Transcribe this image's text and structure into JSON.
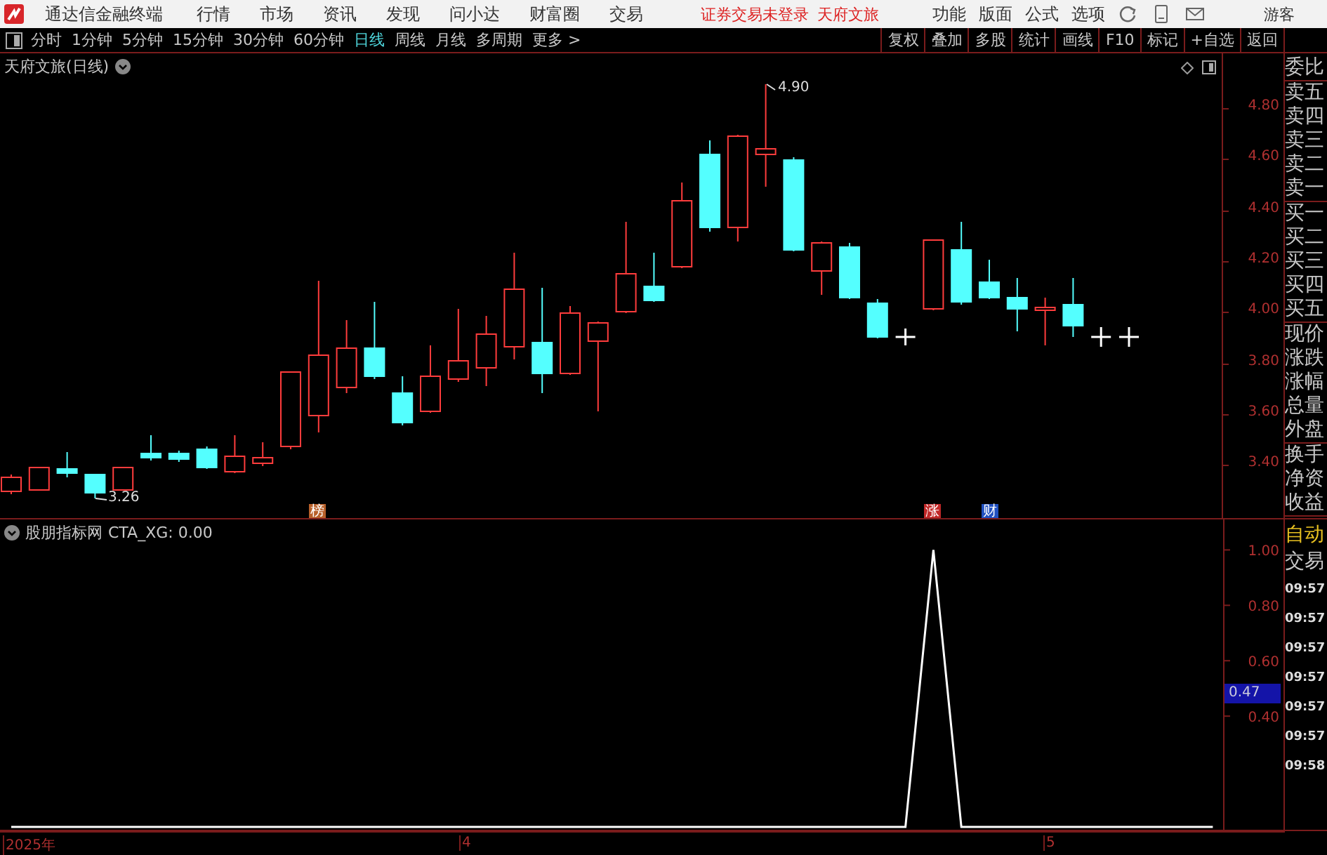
{
  "menu_bar": {
    "app_title": "通达信金融终端",
    "items": [
      "行情",
      "市场",
      "资讯",
      "发现",
      "问小达",
      "财富圈",
      "交易"
    ],
    "login_status": "证券交易未登录",
    "stock_name": "天府文旅",
    "right_items": [
      "功能",
      "版面",
      "公式",
      "选项"
    ],
    "user": "游客"
  },
  "period_bar": {
    "periods": [
      {
        "label": "分时",
        "selected": false
      },
      {
        "label": "1分钟",
        "selected": false
      },
      {
        "label": "5分钟",
        "selected": false
      },
      {
        "label": "15分钟",
        "selected": false
      },
      {
        "label": "30分钟",
        "selected": false
      },
      {
        "label": "60分钟",
        "selected": false
      },
      {
        "label": "日线",
        "selected": true
      },
      {
        "label": "周线",
        "selected": false
      },
      {
        "label": "月线",
        "selected": false
      },
      {
        "label": "多周期",
        "selected": false
      },
      {
        "label": "更多 >",
        "selected": false
      }
    ],
    "tools": [
      "复权",
      "叠加",
      "多股",
      "统计",
      "画线",
      "F10",
      "标记",
      "+自选",
      "返回"
    ]
  },
  "main_chart": {
    "title": "天府文旅(日线)",
    "high_label": "4.90",
    "low_label": "3.26",
    "price_ticks": [
      "4.80",
      "4.60",
      "4.40",
      "4.20",
      "4.00",
      "3.80",
      "3.60",
      "3.40"
    ],
    "markers": [
      {
        "label": "榜",
        "color": "#b8602a"
      },
      {
        "label": "涨",
        "color": "#c02828"
      },
      {
        "label": "财",
        "color": "#2050c0"
      }
    ]
  },
  "indicator": {
    "source": "股朋指标网",
    "reading": "CTA_XG: 0.00",
    "cursor_value": "0.47",
    "chart_data": {
      "type": "line",
      "ylim": [
        0,
        1.11
      ],
      "categories": [
        null,
        null,
        null,
        null,
        null,
        null,
        null,
        null,
        null,
        null,
        null,
        null,
        null,
        null,
        null,
        null,
        null,
        null,
        null,
        null,
        null,
        null,
        null,
        null,
        null,
        null,
        null,
        null,
        null,
        null,
        null,
        null,
        null,
        null,
        null,
        null,
        null,
        null,
        null,
        null,
        null,
        null,
        null,
        null
      ],
      "yticks": [
        {
          "value": 0.4,
          "label": "0.40"
        },
        {
          "value": 0.6,
          "label": "0.60"
        },
        {
          "value": 0.8,
          "label": "0.80"
        },
        {
          "value": 1,
          "label": "1.00"
        }
      ],
      "series": [
        {
          "color": "#ffffff",
          "values": [
            0,
            0,
            0,
            0,
            0,
            0,
            0,
            0,
            0,
            0,
            0,
            0,
            0,
            0,
            0,
            0,
            0,
            0,
            0,
            0,
            0,
            0,
            0,
            0,
            0,
            0,
            0,
            0,
            0,
            0,
            0,
            0,
            0,
            1,
            0,
            0,
            0,
            0,
            0,
            0,
            0,
            0,
            0,
            0
          ]
        }
      ]
    }
  },
  "x_axis": [
    "2025年",
    "4",
    "5"
  ],
  "quote_panel": [
    [
      "委比"
    ],
    [
      "卖五",
      "卖四",
      "卖三",
      "卖二",
      "卖一"
    ],
    [
      "买一",
      "买二",
      "买三",
      "买四",
      "买五"
    ],
    [
      "现价",
      "涨跌",
      "涨幅",
      "总量",
      "外盘"
    ],
    [
      "换手",
      "净资",
      "收益"
    ]
  ],
  "trade_panel": {
    "header": [
      "自动",
      "交易"
    ],
    "times": [
      "09:57",
      "09:57",
      "09:57",
      "09:57",
      "09:57",
      "09:57",
      "09:58"
    ]
  }
}
